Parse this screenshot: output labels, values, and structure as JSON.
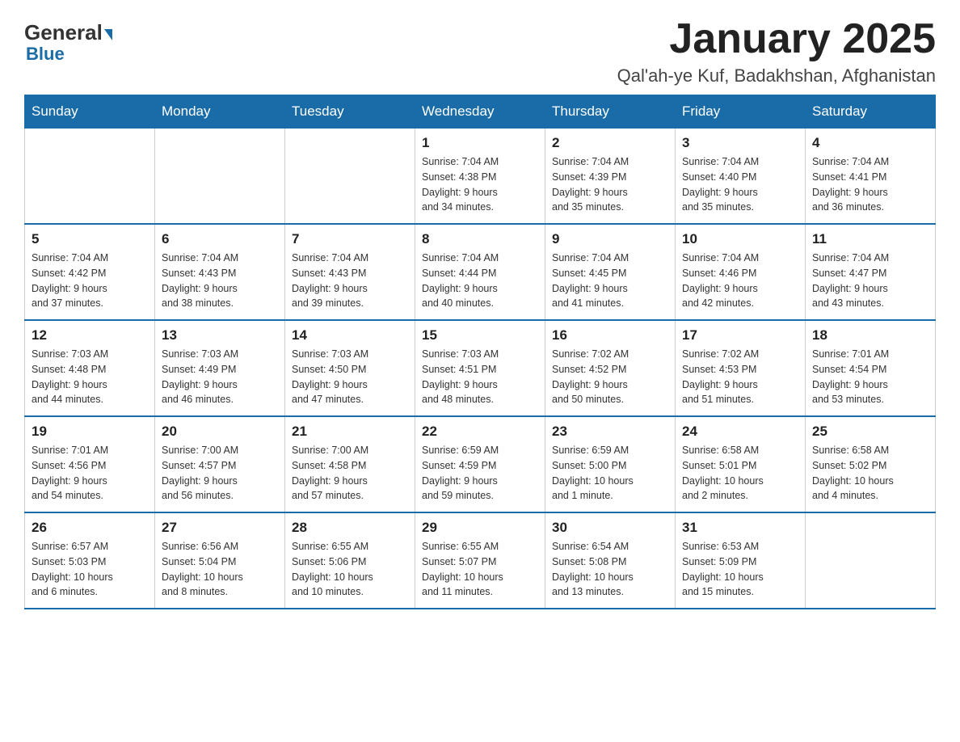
{
  "logo": {
    "general": "General",
    "blue": "Blue"
  },
  "header": {
    "month": "January 2025",
    "location": "Qal'ah-ye Kuf, Badakhshan, Afghanistan"
  },
  "weekdays": [
    "Sunday",
    "Monday",
    "Tuesday",
    "Wednesday",
    "Thursday",
    "Friday",
    "Saturday"
  ],
  "weeks": [
    [
      {
        "day": "",
        "info": ""
      },
      {
        "day": "",
        "info": ""
      },
      {
        "day": "",
        "info": ""
      },
      {
        "day": "1",
        "info": "Sunrise: 7:04 AM\nSunset: 4:38 PM\nDaylight: 9 hours\nand 34 minutes."
      },
      {
        "day": "2",
        "info": "Sunrise: 7:04 AM\nSunset: 4:39 PM\nDaylight: 9 hours\nand 35 minutes."
      },
      {
        "day": "3",
        "info": "Sunrise: 7:04 AM\nSunset: 4:40 PM\nDaylight: 9 hours\nand 35 minutes."
      },
      {
        "day": "4",
        "info": "Sunrise: 7:04 AM\nSunset: 4:41 PM\nDaylight: 9 hours\nand 36 minutes."
      }
    ],
    [
      {
        "day": "5",
        "info": "Sunrise: 7:04 AM\nSunset: 4:42 PM\nDaylight: 9 hours\nand 37 minutes."
      },
      {
        "day": "6",
        "info": "Sunrise: 7:04 AM\nSunset: 4:43 PM\nDaylight: 9 hours\nand 38 minutes."
      },
      {
        "day": "7",
        "info": "Sunrise: 7:04 AM\nSunset: 4:43 PM\nDaylight: 9 hours\nand 39 minutes."
      },
      {
        "day": "8",
        "info": "Sunrise: 7:04 AM\nSunset: 4:44 PM\nDaylight: 9 hours\nand 40 minutes."
      },
      {
        "day": "9",
        "info": "Sunrise: 7:04 AM\nSunset: 4:45 PM\nDaylight: 9 hours\nand 41 minutes."
      },
      {
        "day": "10",
        "info": "Sunrise: 7:04 AM\nSunset: 4:46 PM\nDaylight: 9 hours\nand 42 minutes."
      },
      {
        "day": "11",
        "info": "Sunrise: 7:04 AM\nSunset: 4:47 PM\nDaylight: 9 hours\nand 43 minutes."
      }
    ],
    [
      {
        "day": "12",
        "info": "Sunrise: 7:03 AM\nSunset: 4:48 PM\nDaylight: 9 hours\nand 44 minutes."
      },
      {
        "day": "13",
        "info": "Sunrise: 7:03 AM\nSunset: 4:49 PM\nDaylight: 9 hours\nand 46 minutes."
      },
      {
        "day": "14",
        "info": "Sunrise: 7:03 AM\nSunset: 4:50 PM\nDaylight: 9 hours\nand 47 minutes."
      },
      {
        "day": "15",
        "info": "Sunrise: 7:03 AM\nSunset: 4:51 PM\nDaylight: 9 hours\nand 48 minutes."
      },
      {
        "day": "16",
        "info": "Sunrise: 7:02 AM\nSunset: 4:52 PM\nDaylight: 9 hours\nand 50 minutes."
      },
      {
        "day": "17",
        "info": "Sunrise: 7:02 AM\nSunset: 4:53 PM\nDaylight: 9 hours\nand 51 minutes."
      },
      {
        "day": "18",
        "info": "Sunrise: 7:01 AM\nSunset: 4:54 PM\nDaylight: 9 hours\nand 53 minutes."
      }
    ],
    [
      {
        "day": "19",
        "info": "Sunrise: 7:01 AM\nSunset: 4:56 PM\nDaylight: 9 hours\nand 54 minutes."
      },
      {
        "day": "20",
        "info": "Sunrise: 7:00 AM\nSunset: 4:57 PM\nDaylight: 9 hours\nand 56 minutes."
      },
      {
        "day": "21",
        "info": "Sunrise: 7:00 AM\nSunset: 4:58 PM\nDaylight: 9 hours\nand 57 minutes."
      },
      {
        "day": "22",
        "info": "Sunrise: 6:59 AM\nSunset: 4:59 PM\nDaylight: 9 hours\nand 59 minutes."
      },
      {
        "day": "23",
        "info": "Sunrise: 6:59 AM\nSunset: 5:00 PM\nDaylight: 10 hours\nand 1 minute."
      },
      {
        "day": "24",
        "info": "Sunrise: 6:58 AM\nSunset: 5:01 PM\nDaylight: 10 hours\nand 2 minutes."
      },
      {
        "day": "25",
        "info": "Sunrise: 6:58 AM\nSunset: 5:02 PM\nDaylight: 10 hours\nand 4 minutes."
      }
    ],
    [
      {
        "day": "26",
        "info": "Sunrise: 6:57 AM\nSunset: 5:03 PM\nDaylight: 10 hours\nand 6 minutes."
      },
      {
        "day": "27",
        "info": "Sunrise: 6:56 AM\nSunset: 5:04 PM\nDaylight: 10 hours\nand 8 minutes."
      },
      {
        "day": "28",
        "info": "Sunrise: 6:55 AM\nSunset: 5:06 PM\nDaylight: 10 hours\nand 10 minutes."
      },
      {
        "day": "29",
        "info": "Sunrise: 6:55 AM\nSunset: 5:07 PM\nDaylight: 10 hours\nand 11 minutes."
      },
      {
        "day": "30",
        "info": "Sunrise: 6:54 AM\nSunset: 5:08 PM\nDaylight: 10 hours\nand 13 minutes."
      },
      {
        "day": "31",
        "info": "Sunrise: 6:53 AM\nSunset: 5:09 PM\nDaylight: 10 hours\nand 15 minutes."
      },
      {
        "day": "",
        "info": ""
      }
    ]
  ]
}
